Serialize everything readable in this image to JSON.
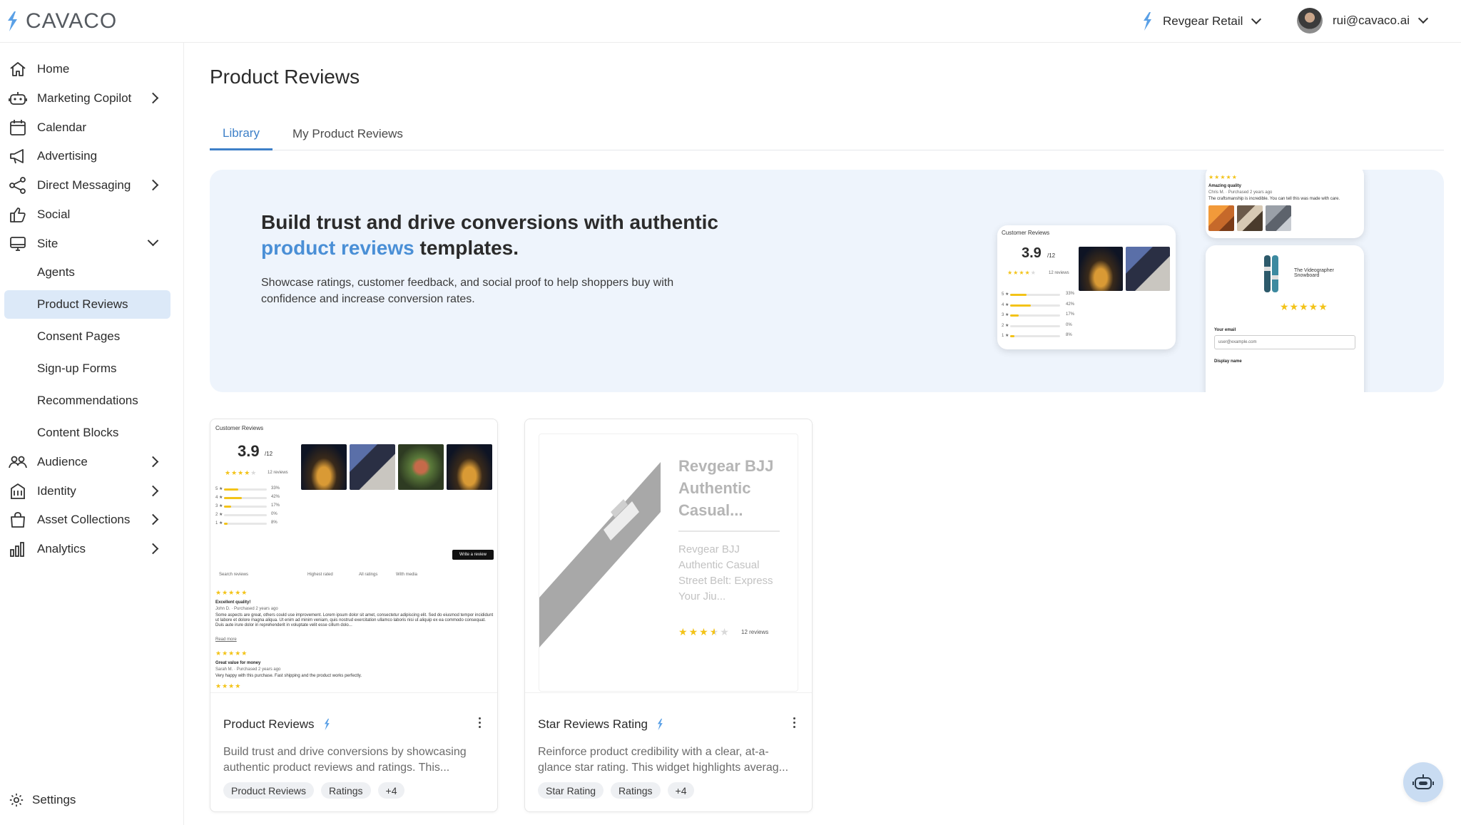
{
  "brand": {
    "name": "CAVACO",
    "accent": "#3e80c8",
    "active_bg": "#dce9f8"
  },
  "topbar": {
    "org": "Revgear Retail",
    "user_email": "rui@cavaco.ai"
  },
  "sidebar": {
    "items": [
      {
        "label": "Home",
        "icon": "home-icon"
      },
      {
        "label": "Marketing Copilot",
        "icon": "robot-icon"
      },
      {
        "label": "Calendar",
        "icon": "calendar-icon"
      },
      {
        "label": "Advertising",
        "icon": "megaphone-icon"
      },
      {
        "label": "Direct Messaging",
        "icon": "share-icon"
      },
      {
        "label": "Social",
        "icon": "thumbs-up-icon"
      },
      {
        "label": "Site",
        "icon": "monitor-icon"
      },
      {
        "label": "Audience",
        "icon": "people-icon"
      },
      {
        "label": "Identity",
        "icon": "building-icon"
      },
      {
        "label": "Asset Collections",
        "icon": "bag-icon"
      },
      {
        "label": "Analytics",
        "icon": "bar-chart-icon"
      }
    ],
    "site_subitems": [
      "Agents",
      "Product Reviews",
      "Consent Pages",
      "Sign-up Forms",
      "Recommendations",
      "Content Blocks"
    ],
    "settings": "Settings"
  },
  "main": {
    "title": "Product Reviews",
    "tabs": [
      "Library",
      "My Product Reviews"
    ],
    "hero": {
      "title_pre": "Build trust and drive conversions with authentic",
      "title_highlight": "product reviews",
      "title_post": "templates.",
      "subtitle": "Showcase ratings, customer feedback, and social proof to help shoppers buy with confidence and increase conversion rates.",
      "preview_summary": {
        "heading": "Customer Reviews",
        "rating": "3.9",
        "out_of": "/12",
        "reviews": "12 reviews",
        "breakdown": [
          {
            "label": "5",
            "pct": "33%",
            "value": 0.33
          },
          {
            "label": "4",
            "pct": "42%",
            "value": 0.42
          },
          {
            "label": "3",
            "pct": "17%",
            "value": 0.17
          },
          {
            "label": "2",
            "pct": "0%",
            "value": 0.0
          },
          {
            "label": "1",
            "pct": "8%",
            "value": 0.08
          }
        ]
      },
      "preview_review": {
        "title": "Amazing quality",
        "author": "Chris M.",
        "meta": "Purchased 2 years ago",
        "text": "The craftsmanship is incredible. You can tell this was made with care."
      },
      "preview_form": {
        "product": "The Videographer Snowboard",
        "email_label": "Your email",
        "email_placeholder": "user@example.com",
        "name_label": "Display name"
      }
    },
    "cards": [
      {
        "title": "Product Reviews",
        "description": "Build trust and drive conversions by showcasing authentic product reviews and ratings. This...",
        "chips": [
          "Product Reviews",
          "Ratings",
          "+4"
        ],
        "preview": {
          "heading": "Customer Reviews",
          "rating": "3.9",
          "out_of": "/12",
          "reviews": "12 reviews",
          "breakdown": [
            {
              "label": "5",
              "pct": "33%",
              "value": 0.33
            },
            {
              "label": "4",
              "pct": "42%",
              "value": 0.42
            },
            {
              "label": "3",
              "pct": "17%",
              "value": 0.17
            },
            {
              "label": "2",
              "pct": "0%",
              "value": 0.0
            },
            {
              "label": "1",
              "pct": "8%",
              "value": 0.08
            }
          ],
          "write_review": "Write a review",
          "search_placeholder": "Search reviews",
          "sort": "Highest rated",
          "filter": "All ratings",
          "with_media": "With media",
          "review1_title": "Excellent quality!",
          "review1_author": "John D.",
          "review1_meta": "Purchased 2 years ago",
          "review1_text": "Some aspects are great, others could use improvement. Lorem ipsum dolor sit amet, consectetur adipiscing elit. Sed do eiusmod tempor incididunt ut labore et dolore magna aliqua. Ut enim ad minim veniam, quis nostrud exercitation ullamco laboris nisi ut aliquip ex ea commodo consequat. Duis aute irure dolor in reprehenderit in voluptate velit esse cillum dolo...",
          "read_more": "Read more",
          "review2_title": "Great value for money",
          "review2_author": "Sarah M.",
          "review2_meta": "Purchased 2 years ago",
          "review2_text": "Very happy with this purchase. Fast shipping and the product works perfectly."
        }
      },
      {
        "title": "Star Reviews Rating",
        "description": "Reinforce product credibility with a clear, at-a-glance star rating. This widget highlights averag...",
        "chips": [
          "Star Rating",
          "Ratings",
          "+4"
        ],
        "preview": {
          "product_title": "Revgear BJJ Authentic Casual...",
          "product_desc": "Revgear BJJ Authentic Casual Street Belt: Express Your Jiu...",
          "rating": 3.5,
          "reviews": "12 reviews"
        }
      }
    ]
  }
}
